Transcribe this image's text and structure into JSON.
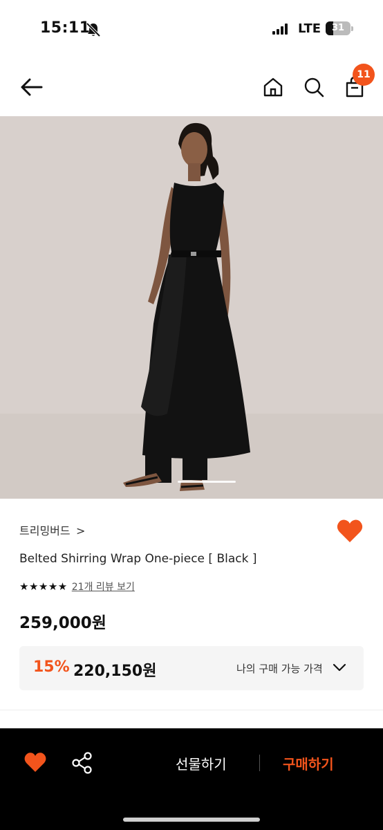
{
  "status_bar": {
    "time": "15:11",
    "network": "LTE",
    "battery_level": "31"
  },
  "nav": {
    "cart_count": "11",
    "icons": [
      "back-arrow-icon",
      "home-icon",
      "search-icon",
      "shopping-bag-icon"
    ]
  },
  "product": {
    "brand": "트리밍버드",
    "brand_chevron": ">",
    "name": "Belted Shirring Wrap One-piece [ Black ]",
    "stars": "★★★★★",
    "rating": 5,
    "review_link": "21개 리뷰 보기",
    "price": "259,000원",
    "discount_rate": "15%",
    "discount_price": "220,150원",
    "my_price_label": "나의 구매 가능 가격",
    "wishlisted": true
  },
  "bottom_bar": {
    "gift_label": "선물하기",
    "buy_label": "구매하기"
  },
  "colors": {
    "accent": "#f2541c",
    "bar_bg": "#000000",
    "price_box_bg": "#f5f5f5",
    "photo_bg": "#d8d0cc"
  }
}
